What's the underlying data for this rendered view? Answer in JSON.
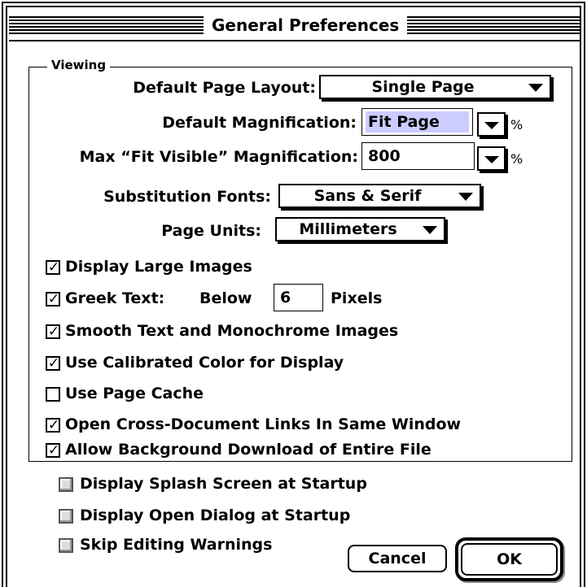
{
  "window": {
    "title": "General Preferences"
  },
  "viewing": {
    "group_title": "Viewing",
    "default_page_layout": {
      "label": "Default Page Layout:",
      "value": "Single Page"
    },
    "default_magnification": {
      "label": "Default Magnification:",
      "value": "Fit Page",
      "unit": "%"
    },
    "max_fit_visible": {
      "label": "Max “Fit Visible” Magnification:",
      "value": "800",
      "unit": "%"
    },
    "substitution_fonts": {
      "label": "Substitution Fonts:",
      "value": "Sans & Serif"
    },
    "page_units": {
      "label": "Page Units:",
      "value": "Millimeters"
    },
    "checkboxes": [
      {
        "label": "Display Large Images",
        "checked": true
      },
      {
        "label": "Greek Text:",
        "checked": true,
        "below_label": "Below",
        "value": "6",
        "unit_label": "Pixels"
      },
      {
        "label": "Smooth Text and Monochrome Images",
        "checked": true
      },
      {
        "label": "Use Calibrated Color for Display",
        "checked": true
      },
      {
        "label": "Use Page Cache",
        "checked": false
      },
      {
        "label": "Open Cross-Document Links In Same Window",
        "checked": true
      },
      {
        "label": "Allow Background Download of Entire File",
        "checked": true
      }
    ]
  },
  "startup": {
    "checkboxes": [
      {
        "label": "Display Splash Screen at Startup",
        "checked": false
      },
      {
        "label": "Display Open Dialog at Startup",
        "checked": false
      },
      {
        "label": "Skip Editing Warnings",
        "checked": false
      }
    ]
  },
  "buttons": {
    "cancel": "Cancel",
    "ok": "OK"
  },
  "icons": {
    "checkmark": "✓",
    "dropdown": "down-triangle-icon"
  },
  "colors": {
    "selection": "#ccccff"
  }
}
